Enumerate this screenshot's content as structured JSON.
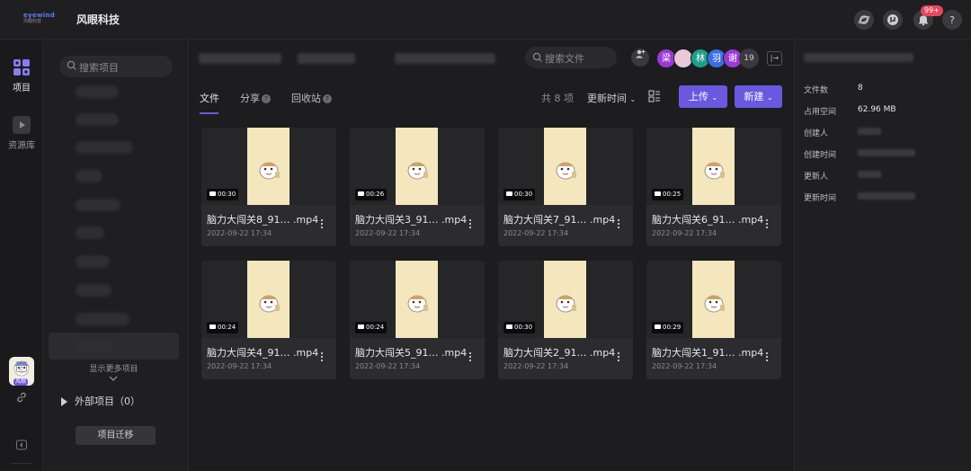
{
  "app": {
    "logo_line1": "eyewind",
    "logo_line2": "风眼科技",
    "brand_name": "风眼科技",
    "notification_badge": "99+",
    "help_label": "?"
  },
  "rail": {
    "project_label": "项目",
    "library_label": "资源库",
    "avatar_tag": "风眼"
  },
  "project_sidebar": {
    "search_placeholder": "搜索项目",
    "show_more": "显示更多项目",
    "external_projects": "外部项目",
    "external_count": "（0）",
    "migrate_label": "项目迁移"
  },
  "main": {
    "search_placeholder": "搜索文件",
    "members": [
      {
        "label": "梁",
        "color": "#9b3ad6"
      },
      {
        "label": "",
        "color": "#e9c9d8"
      },
      {
        "label": "林",
        "color": "#1f9e8b"
      },
      {
        "label": "羽",
        "color": "#3b6fe0"
      },
      {
        "label": "谢",
        "color": "#9b3ad6"
      }
    ],
    "member_count": "19",
    "tabs": [
      {
        "label": "文件",
        "active": true
      },
      {
        "label": "分享",
        "active": false
      },
      {
        "label": "回收站",
        "active": false
      }
    ],
    "total_count": "共 8 项",
    "sort_label": "更新时间",
    "upload_label": "上传",
    "new_label": "新建",
    "files": [
      {
        "name_part": "脑力大闯关8_91…",
        "ext": ".mp4",
        "date": "2022-09-22 17:34",
        "duration": "00:30"
      },
      {
        "name_part": "脑力大闯关3_91…",
        "ext": ".mp4",
        "date": "2022-09-22 17:34",
        "duration": "00:26"
      },
      {
        "name_part": "脑力大闯关7_91…",
        "ext": ".mp4",
        "date": "2022-09-22 17:34",
        "duration": "00:30"
      },
      {
        "name_part": "脑力大闯关6_91…",
        "ext": ".mp4",
        "date": "2022-09-22 17:34",
        "duration": "00:25"
      },
      {
        "name_part": "脑力大闯关4_91…",
        "ext": ".mp4",
        "date": "2022-09-22 17:34",
        "duration": "00:24"
      },
      {
        "name_part": "脑力大闯关5_91…",
        "ext": ".mp4",
        "date": "2022-09-22 17:34",
        "duration": "00:24"
      },
      {
        "name_part": "脑力大闯关2_91…",
        "ext": ".mp4",
        "date": "2022-09-22 17:34",
        "duration": "00:30"
      },
      {
        "name_part": "脑力大闯关1_91…",
        "ext": ".mp4",
        "date": "2022-09-22 17:34",
        "duration": "00:29"
      }
    ]
  },
  "info_panel": {
    "file_count_label": "文件数",
    "file_count_value": "8",
    "space_label": "占用空间",
    "space_value": "62.96 MB",
    "creator_label": "创建人",
    "created_time_label": "创建时间",
    "updater_label": "更新人",
    "updated_time_label": "更新时间"
  },
  "colors": {
    "accent": "#6b58e0",
    "badge": "#e8455c",
    "poster": "#f4e6bd"
  }
}
